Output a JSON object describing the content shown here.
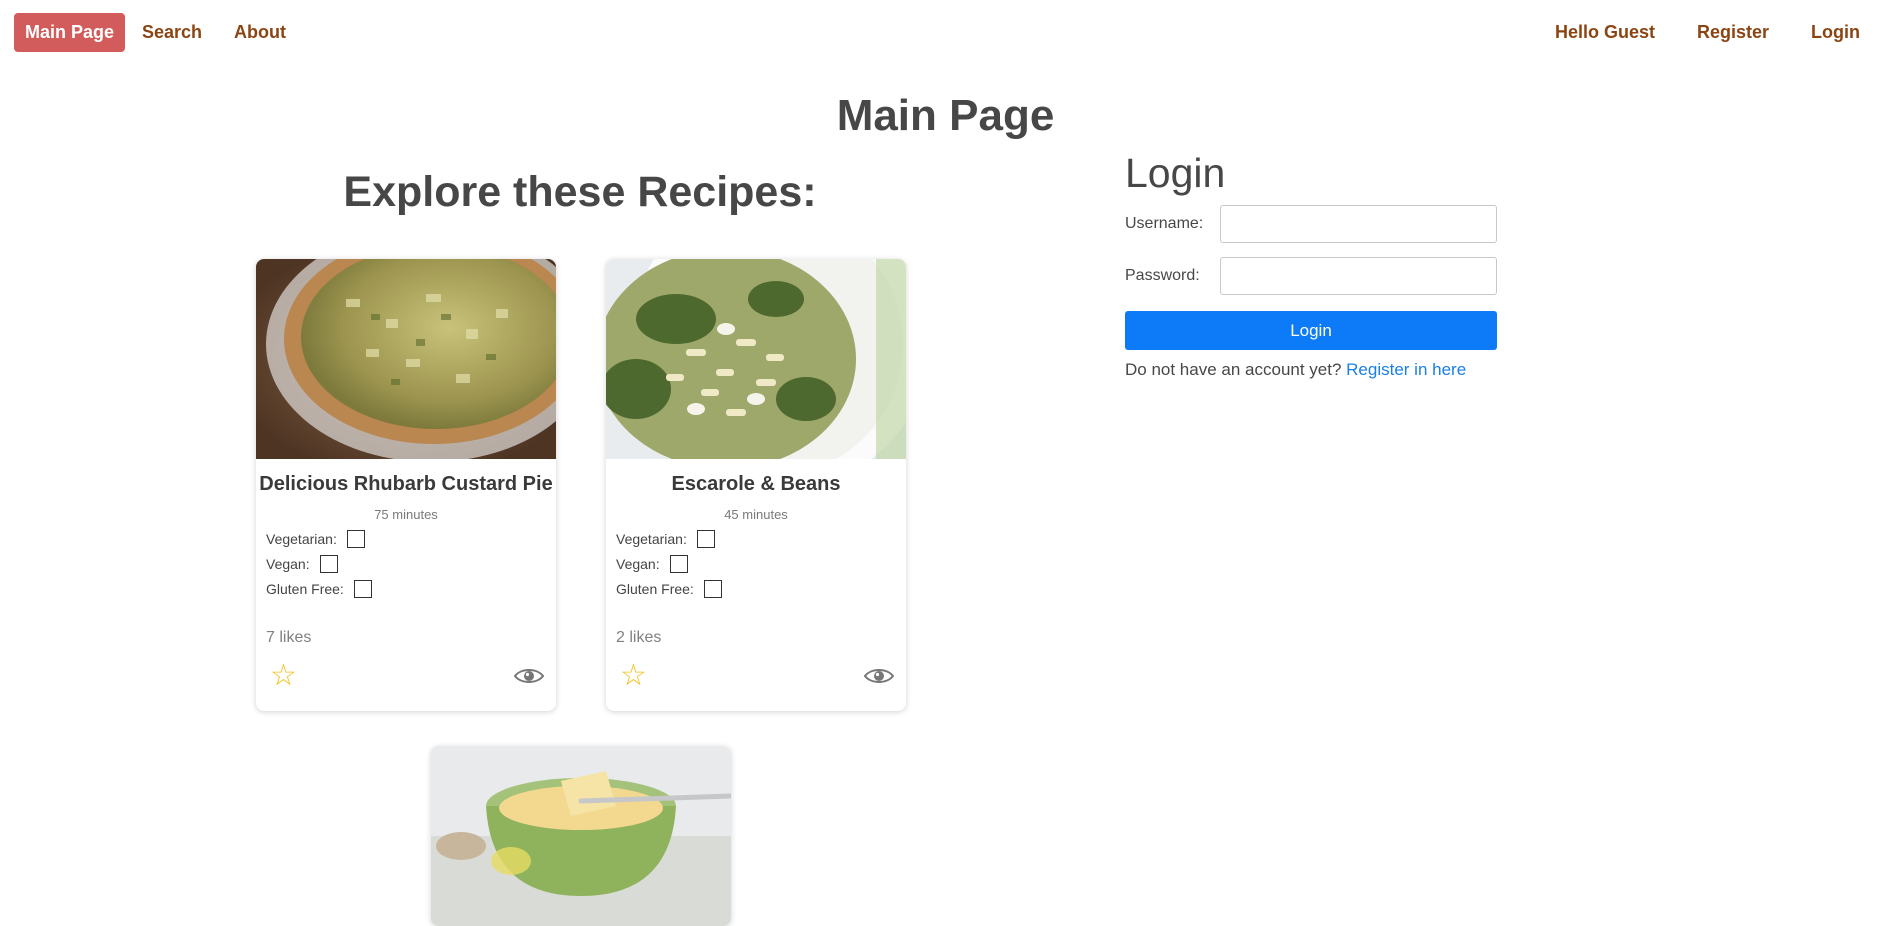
{
  "nav": {
    "active": "Main Page",
    "links": [
      "Search",
      "About"
    ],
    "right": [
      "Hello Guest",
      "Register",
      "Login"
    ]
  },
  "page_title": "Main Page",
  "explore_title": "Explore these Recipes:",
  "recipes": [
    {
      "title": "Delicious Rhubarb Custard Pie",
      "time": "75 minutes",
      "vegetarian_label": "Vegetarian:",
      "vegan_label": "Vegan:",
      "gluten_label": "Gluten Free:",
      "likes": "7 likes",
      "image": "rhubarb-custard-pie-photo"
    },
    {
      "title": "Escarole & Beans",
      "time": "45 minutes",
      "vegetarian_label": "Vegetarian:",
      "vegan_label": "Vegan:",
      "gluten_label": "Gluten Free:",
      "likes": "2 likes",
      "image": "escarole-beans-photo"
    },
    {
      "image": "custard-dessert-photo"
    }
  ],
  "login": {
    "heading": "Login",
    "username_label": "Username:",
    "password_label": "Password:",
    "button": "Login",
    "signup_text": "Do not have an account yet? ",
    "signup_link": "Register in here"
  },
  "colors": {
    "active_nav": "#d25c5c",
    "nav_link": "#8b4513",
    "primary_button": "#0d7bf7",
    "link": "#1a7fe8",
    "star": "#f2c118"
  }
}
